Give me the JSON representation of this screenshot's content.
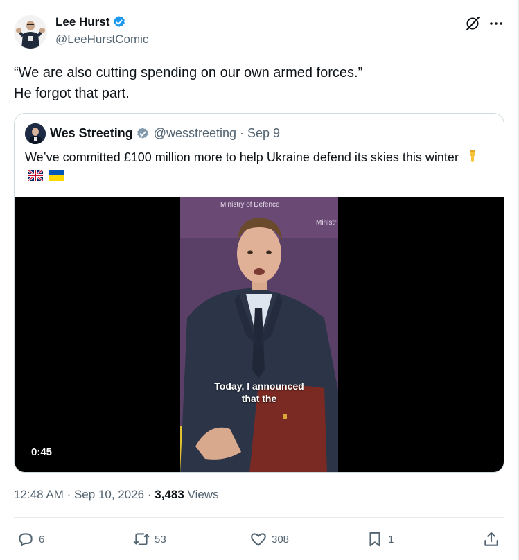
{
  "author": {
    "name": "Lee Hurst",
    "handle": "@LeeHurstComic",
    "verified_icon": "verified-badge-icon",
    "avatar_icon": "avatar"
  },
  "header_icons": [
    "grok-icon",
    "more-icon"
  ],
  "tweet": {
    "text": "“We are also cutting spending on our own armed forces.”\nHe forgot that part."
  },
  "quoted": {
    "name": "Wes Streeting",
    "handle": "@wesstreeting",
    "separator": "·",
    "date": "Sep 9",
    "text": "We’ve committed £100 million more to help Ukraine defend its skies this winter",
    "emojis": [
      "pointing-down-icon",
      "uk-flag-icon",
      "ukraine-flag-icon"
    ],
    "video": {
      "duration": "0:45",
      "caption": "Today, I announced\nthat the",
      "backdrop_text_1": "Ministry of Defence",
      "backdrop_text_2": "Ministr of Defe"
    }
  },
  "meta": {
    "time": "12:48 AM",
    "sep1": "·",
    "date": "Sep 10, 2026",
    "sep2": "·",
    "views_count": "3,483",
    "views_label": "Views"
  },
  "actions": {
    "replies": "6",
    "reposts": "53",
    "likes": "308",
    "bookmarks": "1"
  },
  "colors": {
    "accent": "#1d9bf0",
    "muted": "#536471",
    "text": "#0f1419",
    "border": "#cfd9de",
    "repost": "#536471"
  }
}
